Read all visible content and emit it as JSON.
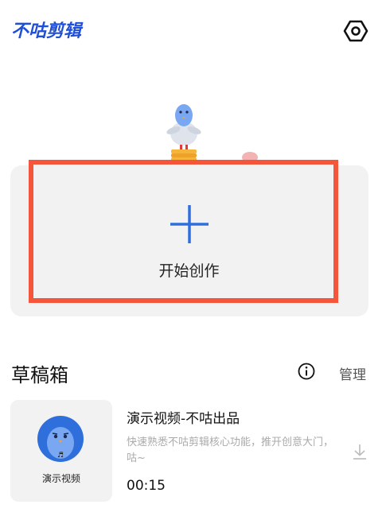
{
  "app": {
    "logo_text": "不咕剪辑",
    "brand_color": "#1f4fd6",
    "settings_icon": "hexagon-settings-icon"
  },
  "create": {
    "label": "开始创作",
    "icon": "plus-icon",
    "accent_color": "#2f6fdc",
    "highlight_color": "#f5553a"
  },
  "drafts": {
    "title": "草稿箱",
    "info_icon": "info-icon",
    "manage_label": "管理",
    "items": [
      {
        "thumb_label": "演示视频",
        "title": "演示视频-不咕出品",
        "description": "快速熟悉不咕剪辑核心功能，推开创意大门，咕~",
        "duration": "00:15",
        "action_icon": "download-icon"
      }
    ]
  }
}
